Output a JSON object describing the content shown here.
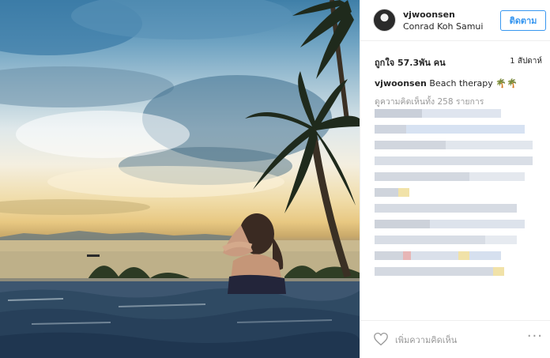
{
  "post": {
    "username": "vjwoonsen",
    "location": "Conrad Koh Samui",
    "follow_label": "ติดตาม",
    "likes": "ถูกใจ 57.3พัน คน",
    "time_ago": "1 สัปดาห์",
    "caption_user": "vjwoonsen",
    "caption_text": "Beach therapy",
    "caption_emoji": "🌴🌴",
    "view_all_comments": "ดูความคิดเห็นทั้ง 258 รายการ",
    "add_comment_placeholder": "เพิ่มความคิดเห็น",
    "more_glyph": "···"
  },
  "icons": {
    "heart": "heart-icon",
    "more": "more-options-icon",
    "avatar": "profile-avatar"
  },
  "colors": {
    "accent": "#3897f0",
    "muted_text": "#999999",
    "border": "#efefef",
    "blurred_comment": "#d6e0ef"
  }
}
